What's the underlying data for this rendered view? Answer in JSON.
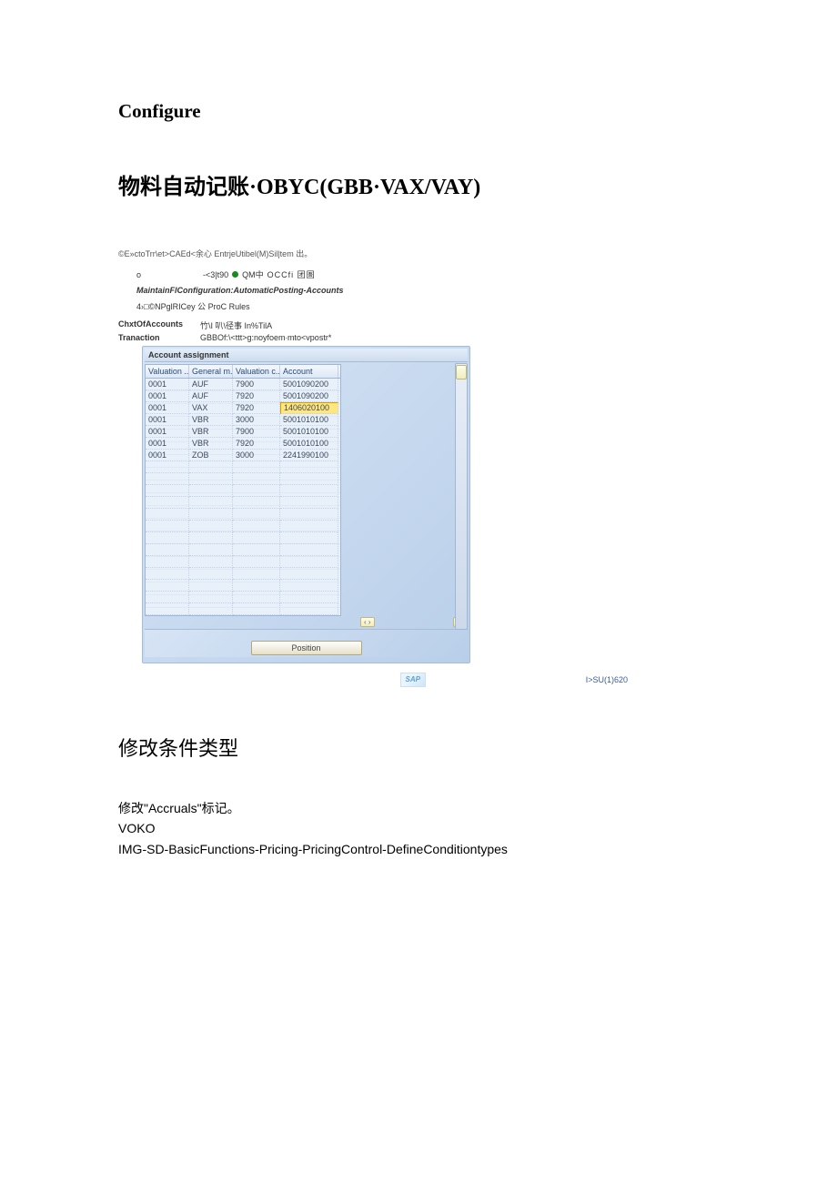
{
  "doc": {
    "h1": "Configure",
    "h2": "物料自动记账·OBYC(GBB·VAX/VAY)",
    "h3": "修改条件类型",
    "para1": "修改\"Accruals\"标记。",
    "para2": "VOKO",
    "para3": "IMG-SD-BasicFunctions-Pricing-PricingControl-DefineConditiontypes"
  },
  "sap": {
    "menu": "©E»ctoTrr\\et>CAEd<余心 EntrjeUtibel(M)Sil|tem 出。",
    "toolbar_prefix": "-<3|t90",
    "toolbar_mid": "QM中",
    "toolbar_suffix": "OCCfi 团圄",
    "title": "MaintainFlConfiguration:AutomaticPosting-Accounts",
    "subtool": "4›□©NPglRICey 公 ProC Rules",
    "info": {
      "coa_label": "ChxtOfAccounts",
      "coa_value": "竹\\I 叭\\径事 In%TilA",
      "trx_label": "Tranaction",
      "trx_value": "GBBOf:\\<ttt>g:noyfoem∙mto<vpostr*"
    },
    "panel_title": "Account assignment",
    "columns": [
      "Valuation ...",
      "General m...",
      "Valuation c...",
      "Account"
    ],
    "rows": [
      {
        "c1": "0001",
        "c2": "AUF",
        "c3": "7900",
        "c4": "5001090200"
      },
      {
        "c1": "0001",
        "c2": "AUF",
        "c3": "7920",
        "c4": "5001090200"
      },
      {
        "c1": "0001",
        "c2": "VAX",
        "c3": "7920",
        "c4": "1406020100",
        "hl": true
      },
      {
        "c1": "0001",
        "c2": "VBR",
        "c3": "3000",
        "c4": "5001010100"
      },
      {
        "c1": "0001",
        "c2": "VBR",
        "c3": "7900",
        "c4": "5001010100"
      },
      {
        "c1": "0001",
        "c2": "VBR",
        "c3": "7920",
        "c4": "5001010100"
      },
      {
        "c1": "0001",
        "c2": "ZOB",
        "c3": "3000",
        "c4": "2241990100"
      }
    ],
    "position_btn": "Position",
    "status": "I>SU(1)620"
  }
}
